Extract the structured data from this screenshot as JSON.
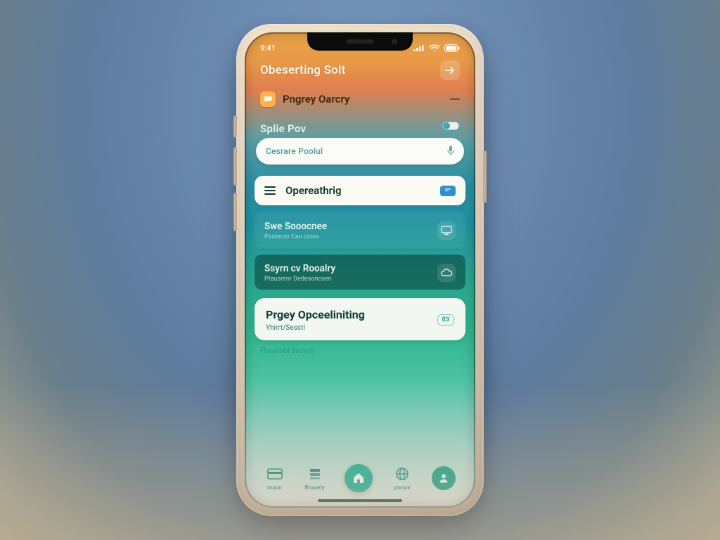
{
  "status": {
    "time": "9:41"
  },
  "header": {
    "title": "Obeserting Solt"
  },
  "row_primary": {
    "label": "Pngrey Oarcry"
  },
  "section_split": {
    "label": "Splie Pov"
  },
  "search": {
    "placeholder": "Cesrare Poolul"
  },
  "card_operating": {
    "label": "Opereathrig"
  },
  "tiles": [
    {
      "title": "Swe Sooocnee",
      "subtitle": "Pssteron Cau coiss"
    },
    {
      "title": "Ssyrn cv Rooalry",
      "subtitle": "Ptausrenr Dedesoncsen"
    }
  ],
  "big_card": {
    "title": "Prgey Opceeliniting",
    "subtitle": "Yhirrt/Sesstl",
    "badge": "03"
  },
  "footnote": "Fhrsembl Ssoycn",
  "tabs": [
    {
      "label": "maun"
    },
    {
      "label": "Rraoely"
    },
    {
      "label": ""
    },
    {
      "label": "ponov"
    },
    {
      "label": ""
    }
  ]
}
